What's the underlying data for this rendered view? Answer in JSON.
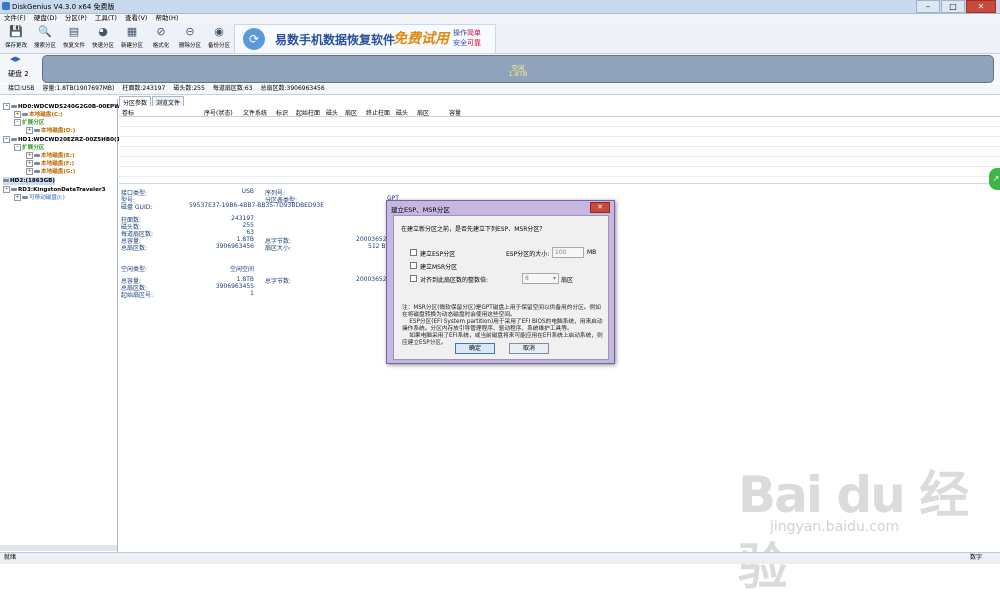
{
  "window": {
    "title": "DiskGenius V4.3.0 x64 免费版"
  },
  "menu": [
    "文件(F)",
    "硬盘(D)",
    "分区(P)",
    "工具(T)",
    "查看(V)",
    "帮助(H)"
  ],
  "toolbar": {
    "buttons": [
      {
        "label": "保存更改",
        "icon": "save-icon"
      },
      {
        "label": "搜索分区",
        "icon": "search-icon"
      },
      {
        "label": "恢复文件",
        "icon": "recover-icon"
      },
      {
        "label": "快速分区",
        "icon": "quick-partition-icon"
      },
      {
        "label": "新建分区",
        "icon": "new-partition-icon"
      },
      {
        "label": "格式化",
        "icon": "format-icon"
      },
      {
        "label": "删除分区",
        "icon": "delete-icon"
      },
      {
        "label": "备份分区",
        "icon": "backup-icon"
      }
    ]
  },
  "ad": {
    "text": "易数手机数据恢复软件",
    "slogan": "免费试用",
    "note1": "操作",
    "note1b": "简单",
    "note2": "安全",
    "note2b": "可靠"
  },
  "diskmap": {
    "label": "硬盘 2",
    "free": "空闲",
    "size": "1.8TB"
  },
  "diskinfo": {
    "iface": "接口:USB",
    "capacity": "容量:1.8TB(1907697MB)",
    "cyl": "柱面数:243197",
    "heads": "磁头数:255",
    "spt": "每道扇区数:63",
    "sectors": "总扇区数:3906963456"
  },
  "tree": [
    {
      "text": "HD0:WDCWDS240G2G0B-00EPW0",
      "kind": "disk"
    },
    {
      "text": "本地磁盘(C:)",
      "kind": "vol"
    },
    {
      "text": "扩展分区",
      "kind": "ext"
    },
    {
      "text": "本地磁盘(D:)",
      "kind": "vol"
    },
    {
      "text": "HD1:WDCWD20EZRZ-00Z5HB0(1",
      "kind": "disk"
    },
    {
      "text": "扩展分区",
      "kind": "ext"
    },
    {
      "text": "本地磁盘(E:)",
      "kind": "vol"
    },
    {
      "text": "本地磁盘(F:)",
      "kind": "vol"
    },
    {
      "text": "本地磁盘(G:)",
      "kind": "vol"
    },
    {
      "text": "HD2:(1863GB)",
      "kind": "disk"
    },
    {
      "text": "RD3:KingstonDataTraveler3",
      "kind": "disk"
    },
    {
      "text": "可移动磁盘(I:)",
      "kind": "usb"
    }
  ],
  "tabs": [
    "分区参数",
    "浏览文件"
  ],
  "columns": [
    "卷标",
    "序号(状态)",
    "文件系统",
    "标识",
    "起始柱面",
    "磁头",
    "扇区",
    "终止柱面",
    "磁头",
    "扇区",
    "容量"
  ],
  "props": {
    "iface_l": "接口类型:",
    "iface_v": "USB",
    "serial_l": "序列号:",
    "model_l": "型号:",
    "ptype_l": "分区表类型:",
    "ptype_v": "GPT",
    "guid_l": "磁盘 GUID:",
    "guid_v": "59537E37-19B6-4BB7-BB35-7D93BDBED93E",
    "cyl_l": "柱面数:",
    "cyl_v": "243197",
    "heads_l": "磁头数:",
    "heads_v": "255",
    "spt_l": "每道扇区数:",
    "spt_v": "63",
    "cap_l": "总容量:",
    "cap_v": "1.8TB",
    "bytes_l": "总字节数:",
    "bytes_v": "2000365289",
    "secs_l": "总扇区数:",
    "secs_v": "3906963456",
    "secsize_l": "扇区大小:",
    "secsize_v": "512 B",
    "space_l": "空闲类型:",
    "space_v": "空闲空间",
    "cap2_l": "总容量:",
    "cap2_v": "1.8TB",
    "bytes2_l": "总字节数:",
    "bytes2_v": "2000365289",
    "secs2_l": "总扇区数:",
    "secs2_v": "3906963455",
    "start_l": "起始扇区号:",
    "start_v": "1"
  },
  "dialog": {
    "title": "建立ESP、MSR分区",
    "question": "在建立新分区之前，是否先建立下列ESP、MSR分区？",
    "esp_label": "建立ESP分区",
    "esp_size_label": "ESP分区的大小:",
    "esp_size_value": "100",
    "esp_unit": "MB",
    "msr_label": "建立MSR分区",
    "align_label": "对齐到此扇区数的整数倍:",
    "align_value": "8",
    "align_unit": "扇区",
    "note": "注：MSR分区(微软保留分区)是GPT磁盘上用于保留空间以供备用的分区。例如在将磁盘转换为动态磁盘时会使用这些空间。\n    ESP分区(EFI System partition)用于采用了EFI BIOS的电脑系统，用来启动操作系统。分区内存放引导管理程序、驱动程序、系统维护工具等。\n    如果电脑采用了EFI系统，或当前磁盘将来可能应用在EFI系统上启动系统，则应建立ESP分区。",
    "ok": "确定",
    "cancel": "取消"
  },
  "status": {
    "left": "就绪",
    "right": "数字"
  },
  "watermark": {
    "brand": "Bai du 经验",
    "url": "jingyan.baidu.com"
  }
}
